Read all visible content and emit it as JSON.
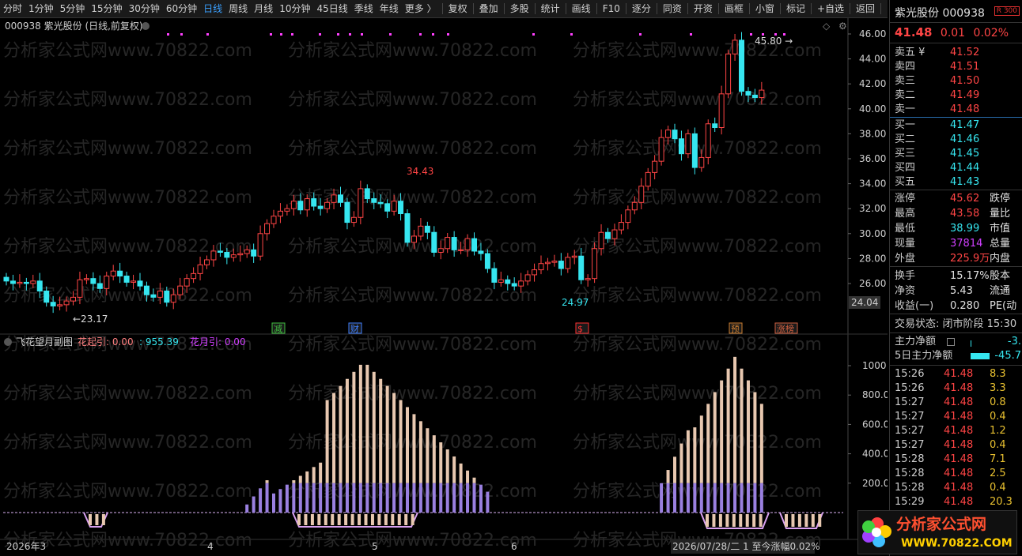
{
  "toolbar": {
    "periods": [
      "分时",
      "1分钟",
      "5分钟",
      "15分钟",
      "30分钟",
      "60分钟",
      "日线",
      "周线",
      "月线",
      "10分钟",
      "45日线",
      "季线",
      "年线",
      "更多 〉"
    ],
    "active_period": "日线",
    "tools": [
      "复权",
      "叠加",
      "多股",
      "统计",
      "画线",
      "F10",
      "逐分",
      "同资",
      "开资",
      "画框",
      "小窗",
      "标记",
      "+自选",
      "返回"
    ]
  },
  "chart": {
    "title": "000938 紫光股份 (日线,前复权)",
    "watermark": "分析家公式网www.70822.com",
    "price_axis": [
      "46.00",
      "44.00",
      "42.00",
      "40.00",
      "38.00",
      "36.00",
      "34.00",
      "32.00",
      "30.00",
      "28.00",
      "26.00"
    ],
    "last_price_tag": "24.04",
    "annotations": {
      "high": "45.80",
      "mid_high": "34.43",
      "low": "24.97",
      "first_low": "23.17"
    },
    "event_markers": [
      "减",
      "财",
      "$",
      "预",
      "涨榜"
    ]
  },
  "sub_chart": {
    "title": "飞花望月副图",
    "label1": "花起引: 0.00",
    "label2": ": 955.39",
    "label3": "花月引: 0.00",
    "axis": [
      "1000",
      "800.0",
      "600.0",
      "400.0",
      "200.0"
    ]
  },
  "date_axis": {
    "labels": [
      "2026年3",
      "4",
      "5",
      "6"
    ],
    "status": "2026/07/28/二 1 至今涨幅0.02%"
  },
  "quote": {
    "name": "紫光股份",
    "code": "000938",
    "badge": "R 300",
    "price": "41.48",
    "change": "0.01",
    "pct": "0.02%",
    "asks": [
      {
        "label": "卖五 ¥",
        "price": "41.52"
      },
      {
        "label": "卖四",
        "price": "41.51"
      },
      {
        "label": "卖三",
        "price": "41.50"
      },
      {
        "label": "卖二",
        "price": "41.49"
      },
      {
        "label": "卖一",
        "price": "41.48"
      }
    ],
    "bids": [
      {
        "label": "买一",
        "price": "41.47"
      },
      {
        "label": "买二",
        "price": "41.46"
      },
      {
        "label": "买三",
        "price": "41.45"
      },
      {
        "label": "买四",
        "price": "41.44"
      },
      {
        "label": "买五",
        "price": "41.43"
      }
    ],
    "stats": [
      {
        "l1": "涨停",
        "v1": "45.62",
        "c1": "red",
        "l2": "跌停"
      },
      {
        "l1": "最高",
        "v1": "43.58",
        "c1": "red",
        "l2": "量比"
      },
      {
        "l1": "最低",
        "v1": "38.99",
        "c1": "cyan",
        "l2": "市值"
      },
      {
        "l1": "现量",
        "v1": "37814",
        "c1": "purple",
        "l2": "总量"
      },
      {
        "l1": "外盘",
        "v1": "225.9万",
        "c1": "red",
        "l2": "内盘"
      }
    ],
    "stats2": [
      {
        "l1": "换手",
        "v1": "15.17%",
        "l2": "股本"
      },
      {
        "l1": "净资",
        "v1": "5.43",
        "l2": "流通"
      },
      {
        "l1": "收益(一)",
        "v1": "0.280",
        "l2": "PE(动"
      }
    ],
    "trade_status": "交易状态: 闭市阶段 15:30",
    "main_flow": {
      "label": "主力净额",
      "value": "-3."
    },
    "flow5": {
      "label": "5日主力净额",
      "value": "-45.7"
    },
    "ticks": [
      {
        "t": "15:26",
        "p": "41.48",
        "v": "8.3"
      },
      {
        "t": "15:26",
        "p": "41.48",
        "v": "3.3"
      },
      {
        "t": "15:27",
        "p": "41.48",
        "v": "0.8"
      },
      {
        "t": "15:27",
        "p": "41.48",
        "v": "0.4"
      },
      {
        "t": "15:27",
        "p": "41.48",
        "v": "1.2"
      },
      {
        "t": "15:27",
        "p": "41.48",
        "v": "0.4"
      },
      {
        "t": "15:28",
        "p": "41.48",
        "v": "7.1"
      },
      {
        "t": "15:28",
        "p": "41.48",
        "v": "2.5"
      },
      {
        "t": "15:28",
        "p": "41.48",
        "v": "0.4"
      },
      {
        "t": "15:29",
        "p": "41.48",
        "v": "20.3"
      }
    ],
    "logo_text": "分析家公式网",
    "logo_url": "WWW.70822.COM"
  },
  "colors": {
    "up": "#ff4545",
    "down": "#36e6f0",
    "flower": "#e8c8b0",
    "moon": "#9a80e0",
    "bg": "#000000"
  }
}
